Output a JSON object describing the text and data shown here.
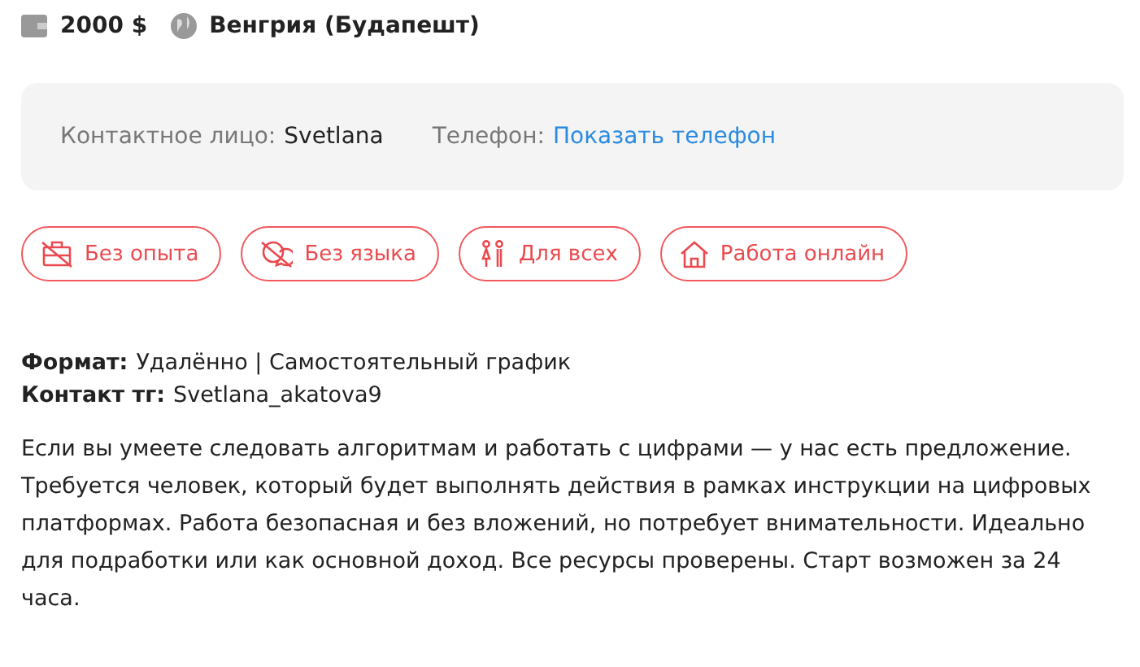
{
  "meta": [
    {
      "kind": "salary",
      "text": "2000 $"
    },
    {
      "kind": "location",
      "text": "Венгрия (Будапешт)"
    }
  ],
  "contact": {
    "person_label": "Контактное лицо:",
    "person": "Svetlana",
    "phone_label": "Телефон:",
    "phone_link": "Показать телефон"
  },
  "tags": [
    {
      "kind": "experience",
      "label": "Без опыта"
    },
    {
      "kind": "language",
      "label": "Без языка"
    },
    {
      "kind": "everyone",
      "label": "Для всех"
    },
    {
      "kind": "online",
      "label": "Работа онлайн"
    }
  ],
  "details": [
    {
      "label": "Формат:",
      "value": "Удалённо | Самостоятельный график"
    },
    {
      "label": "Контакт тг:",
      "value": "Svetlana_akatova9"
    }
  ],
  "description": "Если вы умеете следовать алгоритмам и работать с цифрами — у нас есть предложение. Требуется человек, который будет выполнять действия в рамках инструкции на цифровых платформах. Работа безопасная и без вложений, но потребует внимательности. Идеально для подработки или как основной доход. Все ресурсы проверены. Старт возможен за 24 часа."
}
